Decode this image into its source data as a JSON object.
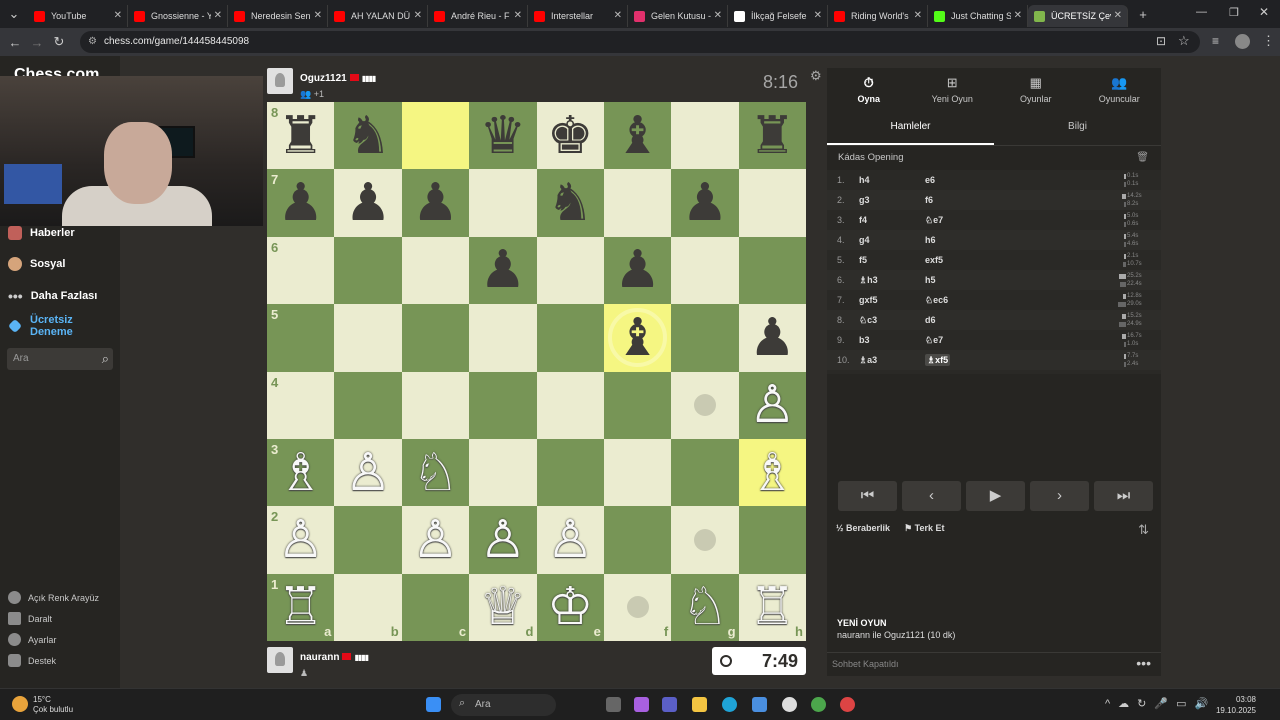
{
  "browser": {
    "tabs": [
      {
        "title": "YouTube",
        "color": "#ff0000"
      },
      {
        "title": "Gnossienne - Y",
        "color": "#ff0000"
      },
      {
        "title": "Neredesin Sen",
        "color": "#ff0000"
      },
      {
        "title": "AH YALAN DÜ",
        "color": "#ff0000"
      },
      {
        "title": "André Rieu - F",
        "color": "#ff0000"
      },
      {
        "title": "Interstellar",
        "color": "#ff0000"
      },
      {
        "title": "Gelen Kutusu -",
        "color": "#e1306c"
      },
      {
        "title": "İlkçağ Felsefe",
        "color": "#ffffff"
      },
      {
        "title": "Riding World's",
        "color": "#ff0000"
      },
      {
        "title": "Just Chatting S",
        "color": "#53fc18"
      },
      {
        "title": "ÜCRETSİZ Çev",
        "color": "#81b64c"
      }
    ],
    "new_tab": "+",
    "url": "chess.com/game/144458445098"
  },
  "sidebar": {
    "logo": "Chess.com",
    "items": [
      {
        "label": "Haberler"
      },
      {
        "label": "Sosyal"
      },
      {
        "label": "Daha Fazlası"
      },
      {
        "label": "Ücretsiz Deneme"
      }
    ],
    "search_placeholder": "Ara",
    "bottom": [
      {
        "label": "Açık Renk Arayüz"
      },
      {
        "label": "Daralt"
      },
      {
        "label": "Ayarlar"
      },
      {
        "label": "Destek"
      }
    ]
  },
  "players": {
    "top": {
      "name": "Oguz1121",
      "sub": "+1",
      "clock": "8:16"
    },
    "bottom": {
      "name": "naurann",
      "clock": "7:49"
    }
  },
  "board": {
    "rows": [
      [
        "r",
        "n",
        "",
        "q",
        "k",
        "b",
        "",
        "r"
      ],
      [
        "p",
        "p",
        "p",
        "",
        "n",
        "",
        "p",
        ""
      ],
      [
        "",
        "",
        "",
        "p",
        "",
        "p",
        "",
        ""
      ],
      [
        "",
        "",
        "",
        "",
        "",
        "b",
        "",
        "p"
      ],
      [
        "",
        "",
        "",
        "",
        "",
        "",
        "",
        "P"
      ],
      [
        "B",
        "P",
        "N",
        "",
        "",
        "",
        "",
        "B"
      ],
      [
        "P",
        "",
        "P",
        "P",
        "P",
        "",
        "",
        ""
      ],
      [
        "R",
        "",
        "",
        "Q",
        "K",
        "",
        "N",
        "R"
      ]
    ],
    "highlights": [
      "c8",
      "f5",
      "h3"
    ],
    "dots": [
      "g4",
      "g2",
      "f1"
    ],
    "selected": "f5",
    "ranks": [
      "8",
      "7",
      "6",
      "5",
      "4",
      "3",
      "2",
      "1"
    ],
    "files": [
      "a",
      "b",
      "c",
      "d",
      "e",
      "f",
      "g",
      "h"
    ]
  },
  "panel": {
    "tabs": [
      {
        "label": "Oyna",
        "icon": "⏱"
      },
      {
        "label": "Yeni Oyun",
        "icon": "⊞"
      },
      {
        "label": "Oyunlar",
        "icon": "▦"
      },
      {
        "label": "Oyuncular",
        "icon": "👥"
      }
    ],
    "subtabs": [
      "Hamleler",
      "Bilgi"
    ],
    "opening": "Kádas Opening",
    "moves": [
      {
        "n": "1.",
        "w": "h4",
        "b": "e6",
        "tw": "0.1s",
        "tb": "0.1s"
      },
      {
        "n": "2.",
        "w": "g3",
        "b": "f6",
        "tw": "14.2s",
        "tb": "8.2s"
      },
      {
        "n": "3.",
        "w": "f4",
        "b": "♘e7",
        "tw": "5.0s",
        "tb": "0.6s"
      },
      {
        "n": "4.",
        "w": "g4",
        "b": "h6",
        "tw": "5.4s",
        "tb": "4.6s"
      },
      {
        "n": "5.",
        "w": "f5",
        "b": "exf5",
        "tw": "2.1s",
        "tb": "10.7s"
      },
      {
        "n": "6.",
        "w": "♗h3",
        "b": "h5",
        "tw": "25.2s",
        "tb": "22.4s"
      },
      {
        "n": "7.",
        "w": "gxf5",
        "b": "♘ec6",
        "tw": "12.8s",
        "tb": "29.0s"
      },
      {
        "n": "8.",
        "w": "♘c3",
        "b": "d6",
        "tw": "15.2s",
        "tb": "24.9s"
      },
      {
        "n": "9.",
        "w": "b3",
        "b": "♘e7",
        "tw": "16.7s",
        "tb": "1.0s"
      },
      {
        "n": "10.",
        "w": "♗a3",
        "b": "♗xf5",
        "tw": "7.7s",
        "tb": "2.4s"
      }
    ],
    "controls": [
      "⏮",
      "‹",
      "▶",
      "›",
      "⏭"
    ],
    "draw_label": "Beraberlik",
    "resign_label": "Terk Et",
    "newgame_title": "YENİ OYUN",
    "newgame_sub": "naurann ile Oguz1121 (10 dk)",
    "chat_placeholder": "Sohbet Kapatıldı"
  },
  "taskbar": {
    "temp": "15°C",
    "weather": "Çok bulutlu",
    "search": "Ara",
    "time": "03:08",
    "date": "19.10.2025"
  }
}
